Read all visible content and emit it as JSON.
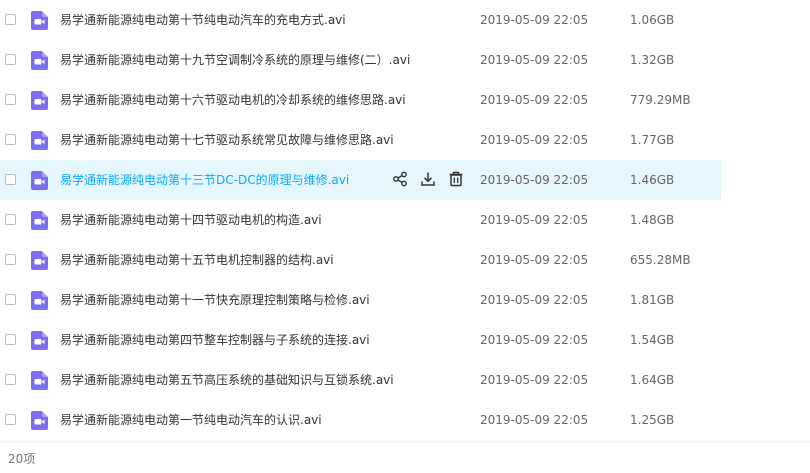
{
  "files": [
    {
      "name": "易学通新能源纯电动第十节纯电动汽车的充电方式.avi",
      "date": "2019-05-09 22:05",
      "size": "1.06GB",
      "hover": false
    },
    {
      "name": "易学通新能源纯电动第十九节空调制冷系统的原理与维修(二）.avi",
      "date": "2019-05-09 22:05",
      "size": "1.32GB",
      "hover": false
    },
    {
      "name": "易学通新能源纯电动第十六节驱动电机的冷却系统的维修思路.avi",
      "date": "2019-05-09 22:05",
      "size": "779.29MB",
      "hover": false
    },
    {
      "name": "易学通新能源纯电动第十七节驱动系统常见故障与维修思路.avi",
      "date": "2019-05-09 22:05",
      "size": "1.77GB",
      "hover": false
    },
    {
      "name": "易学通新能源纯电动第十三节DC-DC的原理与维修.avi",
      "date": "2019-05-09 22:05",
      "size": "1.46GB",
      "hover": true
    },
    {
      "name": "易学通新能源纯电动第十四节驱动电机的构造.avi",
      "date": "2019-05-09 22:05",
      "size": "1.48GB",
      "hover": false
    },
    {
      "name": "易学通新能源纯电动第十五节电机控制器的结构.avi",
      "date": "2019-05-09 22:05",
      "size": "655.28MB",
      "hover": false
    },
    {
      "name": "易学通新能源纯电动第十一节快充原理控制策略与检修.avi",
      "date": "2019-05-09 22:05",
      "size": "1.81GB",
      "hover": false
    },
    {
      "name": "易学通新能源纯电动第四节整车控制器与子系统的连接.avi",
      "date": "2019-05-09 22:05",
      "size": "1.54GB",
      "hover": false
    },
    {
      "name": "易学通新能源纯电动第五节高压系统的基础知识与互锁系统.avi",
      "date": "2019-05-09 22:05",
      "size": "1.64GB",
      "hover": false
    },
    {
      "name": "易学通新能源纯电动第一节纯电动汽车的认识.avi",
      "date": "2019-05-09 22:05",
      "size": "1.25GB",
      "hover": false
    }
  ],
  "icons": {
    "file": "video-file-icon",
    "share": "share-icon",
    "download": "download-icon",
    "delete": "trash-icon"
  },
  "colors": {
    "file_icon": "#7b6ff0",
    "accent": "#09aaff",
    "hover_bg": "#e6f6fd"
  },
  "footer": {
    "count": "20项"
  }
}
